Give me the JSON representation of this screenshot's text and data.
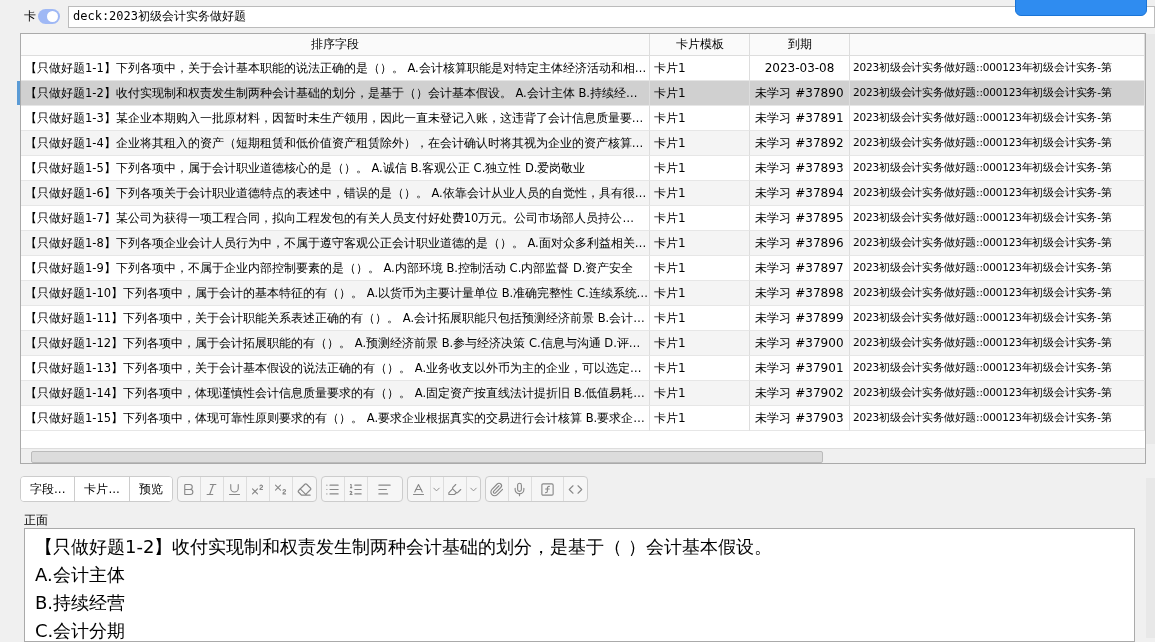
{
  "search": {
    "toggle_label": "卡",
    "on": true,
    "value": "deck:2023初级会计实务做好题"
  },
  "table": {
    "columns": [
      "排序字段",
      "卡片模板",
      "到期"
    ],
    "rows": [
      {
        "sort_field": "【只做好题1-1】下列各项中，关于会计基本职能的说法正确的是（）。 A.会计核算职能是对特定主体经济活动和相…",
        "template": "卡片1",
        "due": "2023-03-08",
        "deck": "2023初级会计实务做好题::000123年初级会计实务-第",
        "selected": false
      },
      {
        "sort_field": "【只做好题1-2】收付实现制和权责发生制两种会计基础的划分，是基于（）会计基本假设。 A.会计主体 B.持续经…",
        "template": "卡片1",
        "due": "未学习 #37890",
        "deck": "2023初级会计实务做好题::000123年初级会计实务-第",
        "selected": true
      },
      {
        "sort_field": "【只做好题1-3】某企业本期购入一批原材料，因暂时未生产领用，因此一直未登记入账，这违背了会计信息质量要…",
        "template": "卡片1",
        "due": "未学习 #37891",
        "deck": "2023初级会计实务做好题::000123年初级会计实务-第",
        "selected": false
      },
      {
        "sort_field": "【只做好题1-4】企业将其租入的资产（短期租赁和低价值资产租赁除外），在会计确认时将其视为企业的资产核算…",
        "template": "卡片1",
        "due": "未学习 #37892",
        "deck": "2023初级会计实务做好题::000123年初级会计实务-第",
        "selected": false
      },
      {
        "sort_field": "【只做好题1-5】下列各项中，属于会计职业道德核心的是（）。 A.诚信 B.客观公正 C.独立性 D.爱岗敬业",
        "template": "卡片1",
        "due": "未学习 #37893",
        "deck": "2023初级会计实务做好题::000123年初级会计实务-第",
        "selected": false
      },
      {
        "sort_field": "【只做好题1-6】下列各项关于会计职业道德特点的表述中，错误的是（）。 A.依靠会计从业人员的自觉性，具有很…",
        "template": "卡片1",
        "due": "未学习 #37894",
        "deck": "2023初级会计实务做好题::000123年初级会计实务-第",
        "selected": false
      },
      {
        "sort_field": "【只做好题1-7】某公司为获得一项工程合同，拟向工程发包的有关人员支付好处费10万元。公司市场部人员持公…",
        "template": "卡片1",
        "due": "未学习 #37895",
        "deck": "2023初级会计实务做好题::000123年初级会计实务-第",
        "selected": false
      },
      {
        "sort_field": "【只做好题1-8】下列各项企业会计人员行为中，不属于遵守客观公正会计职业道德的是（）。 A.面对众多利益相关…",
        "template": "卡片1",
        "due": "未学习 #37896",
        "deck": "2023初级会计实务做好题::000123年初级会计实务-第",
        "selected": false
      },
      {
        "sort_field": "【只做好题1-9】下列各项中，不属于企业内部控制要素的是（）。 A.内部环境 B.控制活动 C.内部监督 D.资产安全",
        "template": "卡片1",
        "due": "未学习 #37897",
        "deck": "2023初级会计实务做好题::000123年初级会计实务-第",
        "selected": false
      },
      {
        "sort_field": "【只做好题1-10】下列各项中，属于会计的基本特征的有（）。 A.以货币为主要计量单位 B.准确完整性 C.连续系统…",
        "template": "卡片1",
        "due": "未学习 #37898",
        "deck": "2023初级会计实务做好题::000123年初级会计实务-第",
        "selected": false
      },
      {
        "sort_field": "【只做好题1-11】下列各项中，关于会计职能关系表述正确的有（）。 A.会计拓展职能只包括预测经济前景 B.会计…",
        "template": "卡片1",
        "due": "未学习 #37899",
        "deck": "2023初级会计实务做好题::000123年初级会计实务-第",
        "selected": false
      },
      {
        "sort_field": "【只做好题1-12】下列各项中，属于会计拓展职能的有（）。 A.预测经济前景 B.参与经济决策 C.信息与沟通 D.评…",
        "template": "卡片1",
        "due": "未学习 #37900",
        "deck": "2023初级会计实务做好题::000123年初级会计实务-第",
        "selected": false
      },
      {
        "sort_field": "【只做好题1-13】下列各项中，关于会计基本假设的说法正确的有（）。 A.业务收支以外币为主的企业，可以选定…",
        "template": "卡片1",
        "due": "未学习 #37901",
        "deck": "2023初级会计实务做好题::000123年初级会计实务-第",
        "selected": false
      },
      {
        "sort_field": "【只做好题1-14】下列各项中，体现谨慎性会计信息质量要求的有（）。 A.固定资产按直线法计提折旧 B.低值易耗…",
        "template": "卡片1",
        "due": "未学习 #37902",
        "deck": "2023初级会计实务做好题::000123年初级会计实务-第",
        "selected": false
      },
      {
        "sort_field": "【只做好题1-15】下列各项中，体现可靠性原则要求的有（）。 A.要求企业根据真实的交易进行会计核算 B.要求企…",
        "template": "卡片1",
        "due": "未学习 #37903",
        "deck": "2023初级会计实务做好题::000123年初级会计实务-第",
        "selected": false
      }
    ]
  },
  "editor": {
    "mode_buttons": [
      "字段...",
      "卡片...",
      "预览"
    ],
    "field_label": "正面",
    "content": [
      "【只做好题1-2】收付实现制和权责发生制两种会计基础的划分，是基于（ ）会计基本假设。",
      "A.会计主体",
      "B.持续经营",
      "C.会计分期"
    ]
  }
}
